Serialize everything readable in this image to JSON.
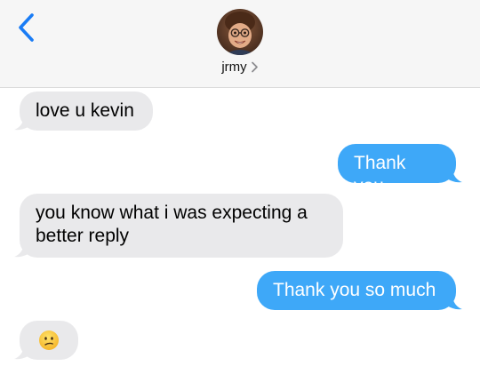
{
  "header": {
    "back_icon": "chevron-left-icon",
    "contact_name": "jrmy",
    "chevron": "chevron-right-icon",
    "accent_color": "#1a7cf5"
  },
  "messages": [
    {
      "direction": "received",
      "text": "love u kevin"
    },
    {
      "direction": "sent",
      "text": "Thank you"
    },
    {
      "direction": "received",
      "text": "you know what i was expecting a better reply"
    },
    {
      "direction": "sent",
      "text": "Thank you so much"
    },
    {
      "direction": "received",
      "emoji": "confused-face-emoji"
    }
  ],
  "colors": {
    "sent_bubble": "#3ea8f8",
    "received_bubble": "#e9e9eb",
    "header_bg": "#f6f6f6"
  }
}
